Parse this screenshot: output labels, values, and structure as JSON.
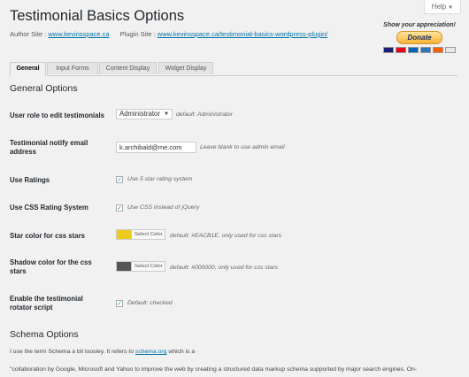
{
  "help": {
    "label": "Help",
    "caret": "▼"
  },
  "page": {
    "title": "Testimonial Basics Options"
  },
  "author": {
    "author_prefix": "Author Site :",
    "author_link": "www.kevinsspace.ca",
    "plugin_prefix": "Plugin Site :",
    "plugin_link": "www.kevinsspace.ca/testimonial-basics-wordpress-plugin/"
  },
  "donate": {
    "appreciation": "Show your appreciation!",
    "button_label": "Donate",
    "card_colors": [
      "#1a1f71",
      "#eb001b",
      "#0066b2",
      "#2e77bc",
      "#ff6000",
      "#e8e8e8"
    ]
  },
  "tabs": [
    {
      "label": "General"
    },
    {
      "label": "Input Forms"
    },
    {
      "label": "Content Display"
    },
    {
      "label": "Widget Display"
    }
  ],
  "general": {
    "title": "General Options",
    "rows": {
      "user_role": {
        "label": "User role to edit testimonials",
        "value": "Administrator",
        "caret": "▼",
        "desc": "default: Administrator"
      },
      "notify_email": {
        "label": "Testimonial notify email address",
        "value": "k.archibald@me.com",
        "desc": "Leave blank to use admin email"
      },
      "ratings": {
        "label": "Use Ratings",
        "check": "✓",
        "desc": "Use 5 star rating system"
      },
      "css_rating": {
        "label": "Use CSS Rating System",
        "check": "✓",
        "desc": "Use CSS instead of jQuery"
      },
      "star_color": {
        "label": "Star color for css stars",
        "swatch": "#eacb1e",
        "button": "Select Color",
        "desc": "default: #EACB1E, only used for css stars"
      },
      "shadow_color": {
        "label": "Shadow color for the css stars",
        "swatch": "#555555",
        "button": "Select Color",
        "desc": "default: #000000, only used for css stars"
      },
      "rotator": {
        "label": "Enable the testimonial rotator script",
        "check": "✓",
        "desc": "Default: checked"
      }
    }
  },
  "schema": {
    "title": "Schema Options",
    "intro_before": "I use the term Schema a bit loosley. It refers to",
    "intro_link": "schema.org",
    "intro_after": "which is a",
    "quote": "\"collaboration by Google, Microsoft and Yahoo to improve the web by creating a structured data markup schema supported by major search engines. On-"
  }
}
